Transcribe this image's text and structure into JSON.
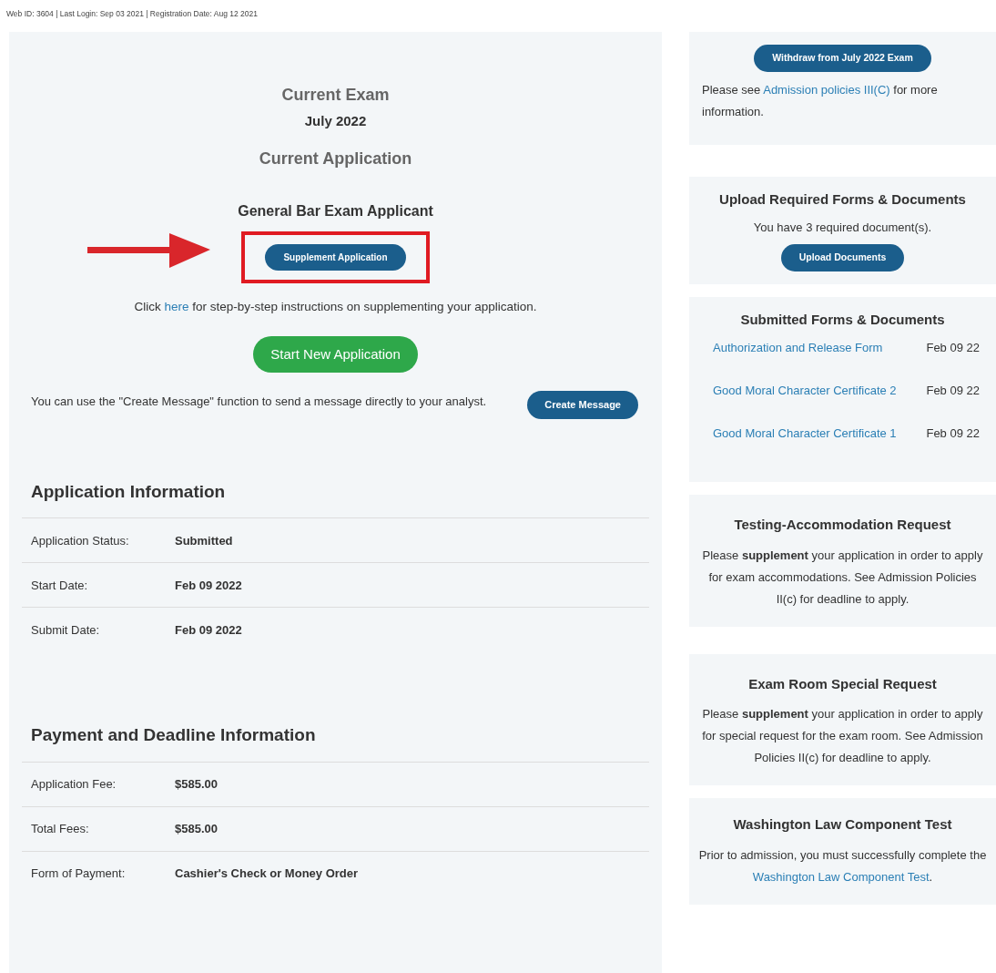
{
  "header": "Web ID: 3604 | Last Login: Sep 03 2021 | Registration Date: Aug 12 2021",
  "main": {
    "exam_heading": "Current Exam",
    "exam_term": "July 2022",
    "application_heading": "Current Application",
    "applicant_type": "General Bar Exam Applicant",
    "supplement_button": {
      "label": "Supplement Application",
      "highlighted": true
    },
    "instructions": {
      "before": "Click ",
      "link": "here",
      "after": " for step-by-step instructions on supplementing your application."
    },
    "start_button": "Start New Application",
    "message": {
      "text": "You can use the \"Create Message\" function to send a message directly to your analyst.",
      "button": "Create Message"
    }
  },
  "sections": [
    {
      "title": "Application Information",
      "rows": [
        {
          "label": "Application Status:",
          "value": "Submitted"
        },
        {
          "label": "Start Date:",
          "value": "Feb 09 2022"
        },
        {
          "label": "Submit Date:",
          "value": "Feb 09 2022"
        }
      ]
    },
    {
      "title": "Payment and Deadline Information",
      "rows": [
        {
          "label": "Application Fee:",
          "value": "$585.00"
        },
        {
          "label": "Total Fees:",
          "value": "$585.00"
        },
        {
          "label": "Form of Payment:",
          "value": "Cashier's Check or Money Order"
        }
      ]
    }
  ],
  "sidebar": [
    {
      "kind": "withdraw",
      "button": "Withdraw from July 2022 Exam",
      "note": {
        "before": "Please see ",
        "link": "Admission policies III(C)",
        "after": " for more information."
      }
    },
    {
      "kind": "upload",
      "title": "Upload Required Forms & Documents",
      "text": "You have 3 required document(s).",
      "button": "Upload Documents"
    },
    {
      "kind": "documents",
      "title": "Submitted Forms & Documents",
      "items": [
        {
          "name": "Authorization and Release Form",
          "date": "Feb 09 22"
        },
        {
          "name": "Good Moral Character Certificate 2",
          "date": "Feb 09 22"
        },
        {
          "name": "Good Moral Character Certificate 1",
          "date": "Feb 09 22"
        }
      ]
    },
    {
      "kind": "info",
      "title": "Testing-Accommodation Request",
      "text": "Please **supplement** your application in order to apply for exam accommodations. See Admission Policies II(c) for deadline to apply."
    },
    {
      "kind": "info",
      "title": "Exam Room Special Request",
      "text": "Please **supplement** your application in order to apply for special request for the exam room. See Admission Policies II(c) for deadline to apply."
    },
    {
      "kind": "link_info",
      "title": "Washington Law Component Test",
      "note": {
        "before": "Prior to admission, you must successfully complete the ",
        "link": "Washington Law Component Test",
        "after": "."
      }
    }
  ]
}
